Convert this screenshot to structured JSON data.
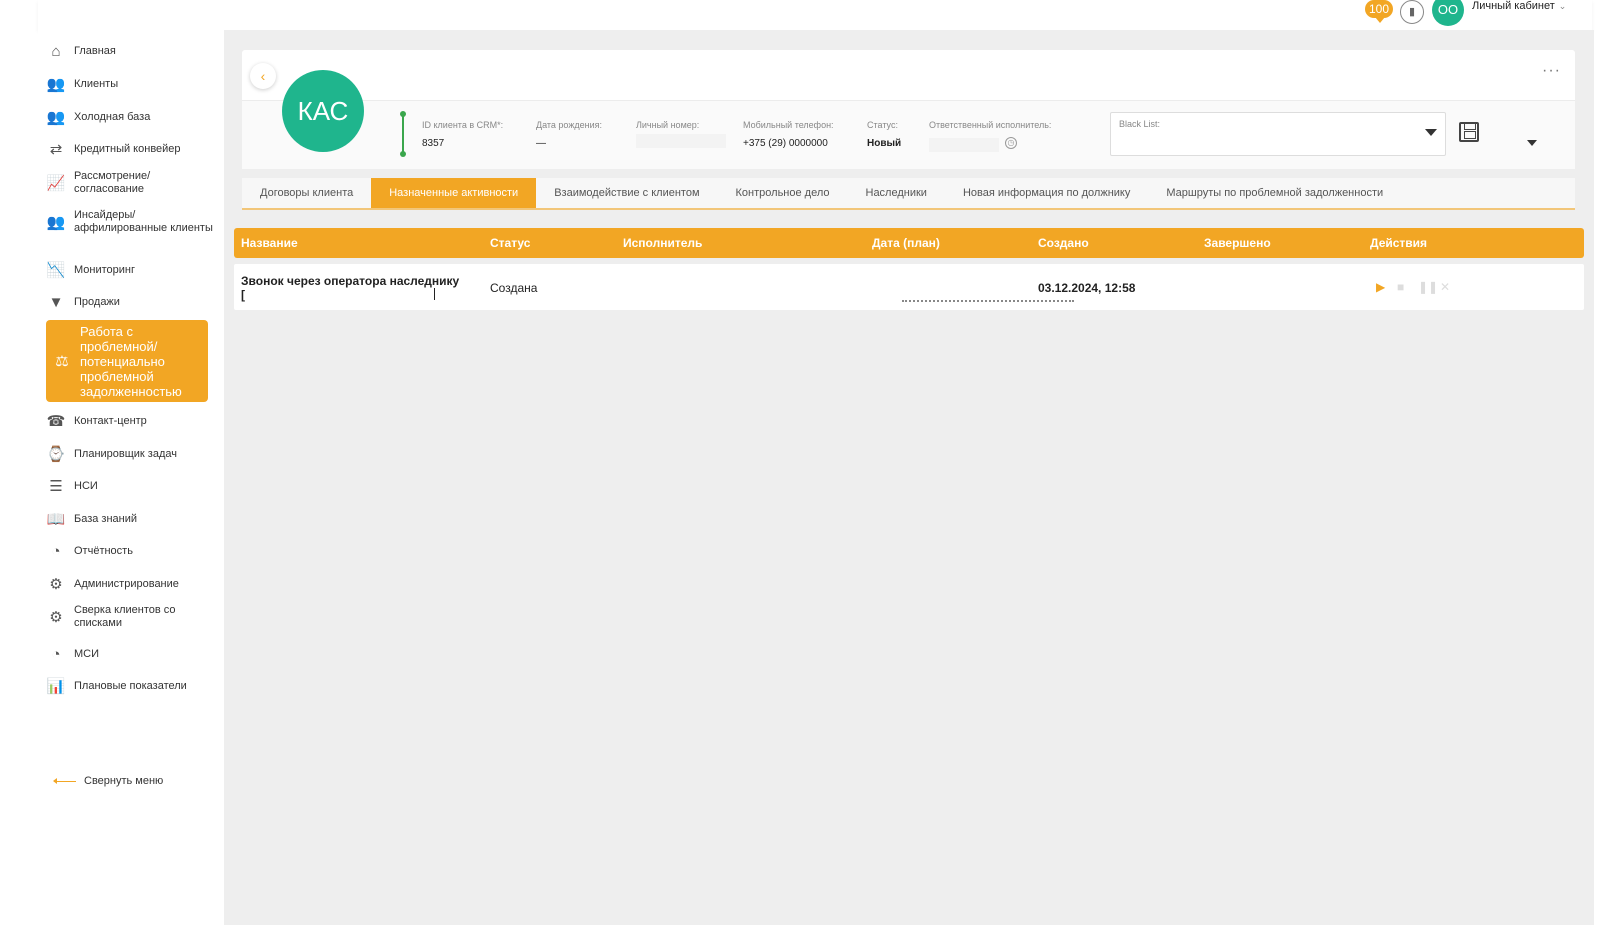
{
  "header": {
    "notifications_count": "100",
    "stats_icon": "signal-icon",
    "avatar_initials": "OO",
    "cabinet_label": "Личный кабинет"
  },
  "sidebar": {
    "items": [
      {
        "label": "Главная",
        "icon": "home-icon"
      },
      {
        "label": "Клиенты",
        "icon": "users-icon"
      },
      {
        "label": "Холодная база",
        "icon": "users-icon"
      },
      {
        "label": "Кредитный конвейер",
        "icon": "conveyor-icon"
      },
      {
        "label": "Рассмотрение/ согласование",
        "icon": "chart-icon"
      },
      {
        "label": "Инсайдеры/ аффилированные клиенты",
        "icon": "insiders-icon"
      },
      {
        "label": "Мониторинг",
        "icon": "monitor-icon"
      },
      {
        "label": "Продажи",
        "icon": "funnel-icon"
      },
      {
        "label": "Работа с проблемной/ потенциально проблемной задолженностью",
        "icon": "debt-icon"
      },
      {
        "label": "Контакт-центр",
        "icon": "phone-icon"
      },
      {
        "label": "Планировщик задач",
        "icon": "planner-icon"
      },
      {
        "label": "НСИ",
        "icon": "list-icon"
      },
      {
        "label": "База знаний",
        "icon": "book-icon"
      },
      {
        "label": "Отчётность",
        "icon": "pie-icon"
      },
      {
        "label": "Администрирование",
        "icon": "gear-icon"
      },
      {
        "label": "Сверка клиентов со списками",
        "icon": "gear-icon"
      },
      {
        "label": "МСИ",
        "icon": "pie-icon"
      },
      {
        "label": "Плановые показатели",
        "icon": "bar-chart-icon"
      }
    ],
    "collapse_label": "Свернуть меню"
  },
  "client": {
    "initials": "КАС",
    "fields": {
      "crm_id_label": "ID клиента в CRM*:",
      "crm_id_value": "8357",
      "birth_label": "Дата рождения:",
      "birth_value": "—",
      "personal_label": "Личный номер:",
      "phone_label": "Мобильный телефон:",
      "phone_value": "+375 (29) 0000000",
      "status_label": "Статус:",
      "status_value": "Новый",
      "responsible_label": "Ответственный исполнитель:"
    },
    "blacklist_label": "Black List:"
  },
  "tabs": [
    {
      "label": "Договоры клиента",
      "active": false
    },
    {
      "label": "Назначенные активности",
      "active": true
    },
    {
      "label": "Взаимодействие с клиентом",
      "active": false
    },
    {
      "label": "Контрольное дело",
      "active": false
    },
    {
      "label": "Наследники",
      "active": false
    },
    {
      "label": "Новая информация по должнику",
      "active": false
    },
    {
      "label": "Маршруты по проблемной задолженности",
      "active": false
    }
  ],
  "table": {
    "columns": [
      "Название",
      "Статус",
      "Исполнитель",
      "Дата (план)",
      "Создано",
      "Завершено",
      "Действия"
    ],
    "rows": [
      {
        "name": "Звонок через оператора наследнику",
        "name_line2": "[",
        "status": "Создана",
        "executor": "",
        "date_plan": "",
        "created": "03.12.2024, 12:58",
        "completed": ""
      }
    ]
  },
  "colors": {
    "accent": "#f2a624",
    "avatar": "#1fb58d"
  }
}
